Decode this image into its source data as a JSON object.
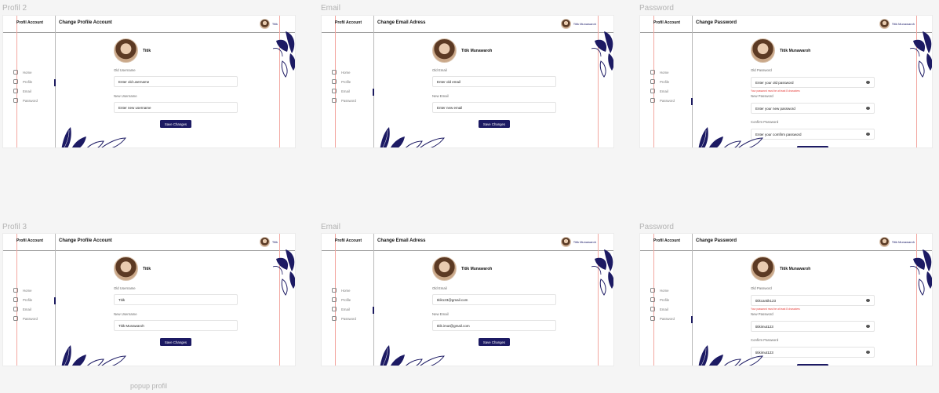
{
  "frames": [
    {
      "label": "Profil 2",
      "brand": "Profil Account",
      "title": "Change Profile Account",
      "user": "Titik",
      "profile_name": "Titik",
      "nav": [
        "Home",
        "Profile",
        "Email",
        "Password"
      ],
      "logout": "Logout",
      "active_index": 1,
      "fields": [
        {
          "label": "Old Username",
          "value": "Enter old username"
        },
        {
          "label": "New Username",
          "value": "Enter new username"
        }
      ],
      "button": "Save Changes"
    },
    {
      "label": "Email",
      "brand": "Profil Account",
      "title": "Change Email Adress",
      "user": "Titik Munawaroh",
      "profile_name": "Titik Munawaroh",
      "nav": [
        "Home",
        "Profile",
        "Email",
        "Password"
      ],
      "logout": "Logout",
      "active_index": 2,
      "fields": [
        {
          "label": "Old Email",
          "value": "Enter old email"
        },
        {
          "label": "New Email",
          "value": "Enter new email"
        }
      ],
      "button": "Save Changes"
    },
    {
      "label": "Password",
      "brand": "Profil Account",
      "title": "Change Password",
      "user": "Titik Munawaroh",
      "profile_name": "Titik Munawaroh",
      "nav": [
        "Home",
        "Profile",
        "Email",
        "Password"
      ],
      "logout": "Logout",
      "active_index": 3,
      "fields": [
        {
          "label": "Old Password",
          "value": "Enter your old password",
          "eye": true,
          "error": "Your password must be at least 8 characters"
        },
        {
          "label": "New Password",
          "value": "Enter your new password",
          "eye": true
        },
        {
          "label": "Confirm Password",
          "value": "Enter your comfirm password",
          "eye": true
        }
      ],
      "button": "Save Changes"
    },
    {
      "label": "Profil 3",
      "brand": "Profil Account",
      "title": "Change Profile Account",
      "user": "Titik",
      "profile_name": "Titik",
      "nav": [
        "Home",
        "Profile",
        "Email",
        "Password"
      ],
      "logout": "Logout",
      "active_index": 1,
      "fields": [
        {
          "label": "Old Username",
          "value": "Titik"
        },
        {
          "label": "New Username",
          "value": "Titik Munawaroh"
        }
      ],
      "button": "Save Changes"
    },
    {
      "label": "Email",
      "brand": "Profil Account",
      "title": "Change Email Adress",
      "user": "Titik Munawaroh",
      "profile_name": "Titik Munawaroh",
      "nav": [
        "Home",
        "Profile",
        "Email",
        "Password"
      ],
      "logout": "Logout",
      "active_index": 2,
      "fields": [
        {
          "label": "Old Email",
          "value": "titik123@gmail.com"
        },
        {
          "label": "New Email",
          "value": "titik.imut@gmail.com"
        }
      ],
      "button": "Save Changes"
    },
    {
      "label": "Password",
      "brand": "Profil Account",
      "title": "Change Password",
      "user": "Titik Munawaroh",
      "profile_name": "Titik Munawaroh",
      "nav": [
        "Home",
        "Profile",
        "Email",
        "Password"
      ],
      "logout": "Logout",
      "active_index": 3,
      "fields": [
        {
          "label": "Old Password",
          "value": "titikcantik123",
          "eye": true,
          "error": "Your password must be at least 8 characters"
        },
        {
          "label": "New Password",
          "value": "titikimut123",
          "eye": true
        },
        {
          "label": "Confirm Password",
          "value": "titikimut123",
          "eye": true
        }
      ],
      "button": "Save Changes"
    }
  ],
  "captions": {
    "popup": "popup profil"
  },
  "colors": {
    "button": "#1c1a63",
    "guide": "#f3a6a0",
    "error": "#e53935"
  }
}
